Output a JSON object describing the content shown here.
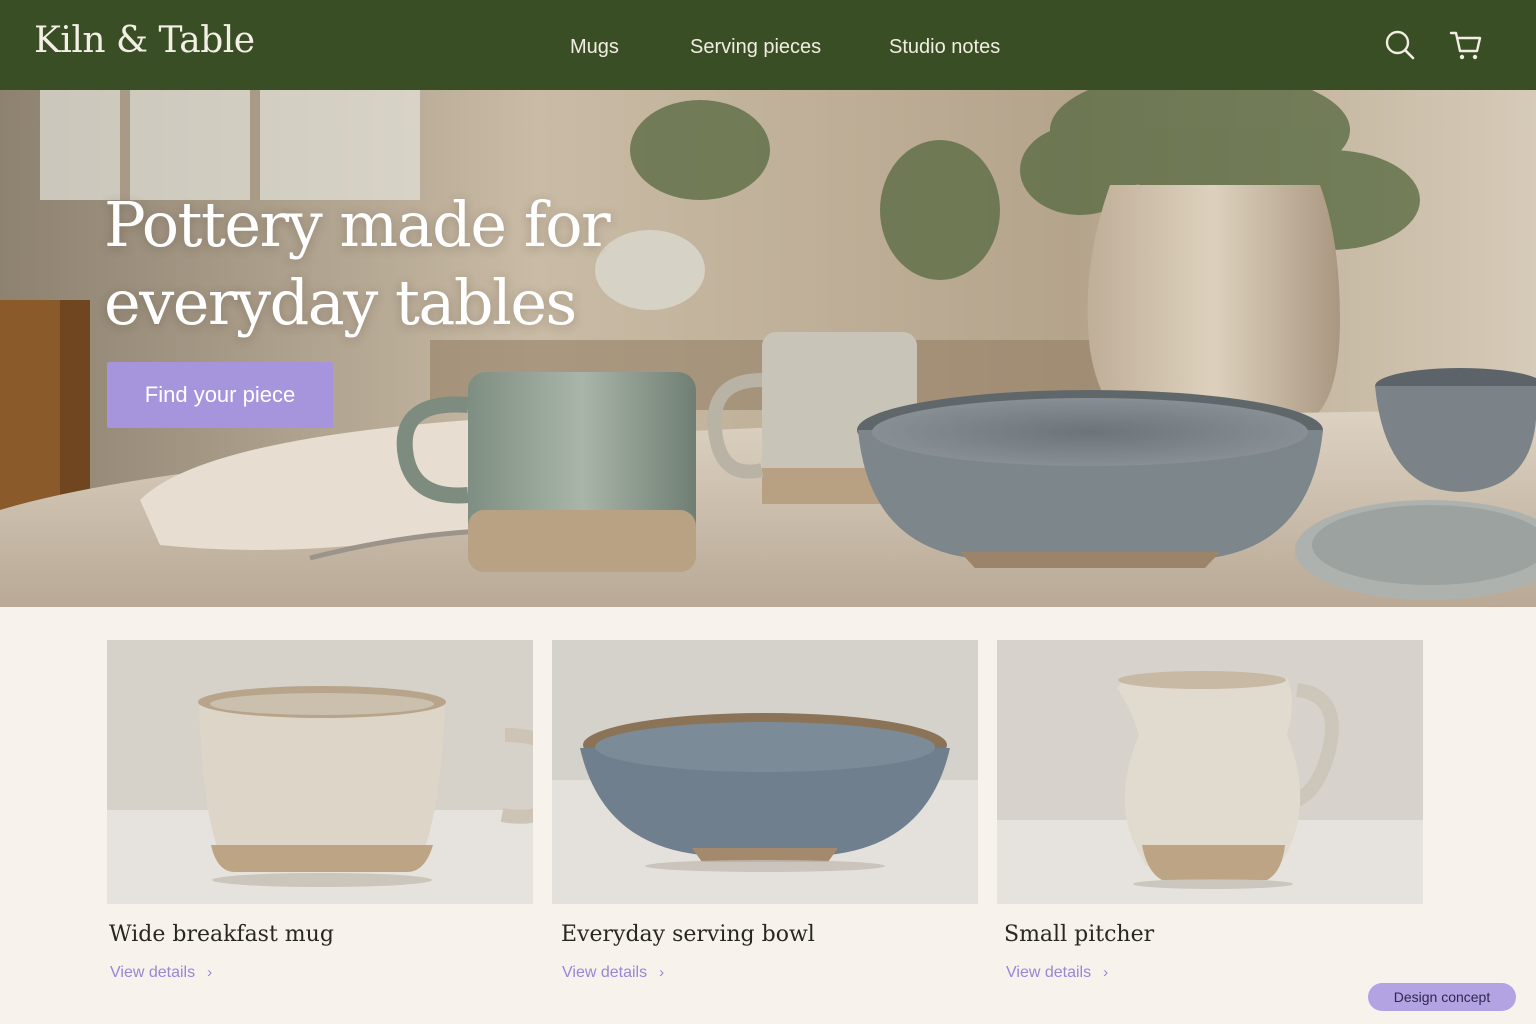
{
  "brand": {
    "name": "Kiln & Table"
  },
  "nav": {
    "items": [
      "Mugs",
      "Serving pieces",
      "Studio notes"
    ]
  },
  "header_icons": {
    "search": "search-icon",
    "cart": "cart-icon"
  },
  "hero": {
    "title_lines": [
      "Pottery made for",
      "everyday tables"
    ],
    "cta_label": "Find your piece"
  },
  "products": [
    {
      "title": "Wide breakfast mug",
      "link": "View details"
    },
    {
      "title": "Everyday serving bowl",
      "link": "View details"
    },
    {
      "title": "Small pitcher",
      "link": "View details"
    }
  ],
  "badge": {
    "label": "Design concept"
  },
  "colors": {
    "header": "#3a4e26",
    "accent": "#a694dd",
    "link": "#9a86d3",
    "page": "#f7f3ec"
  }
}
